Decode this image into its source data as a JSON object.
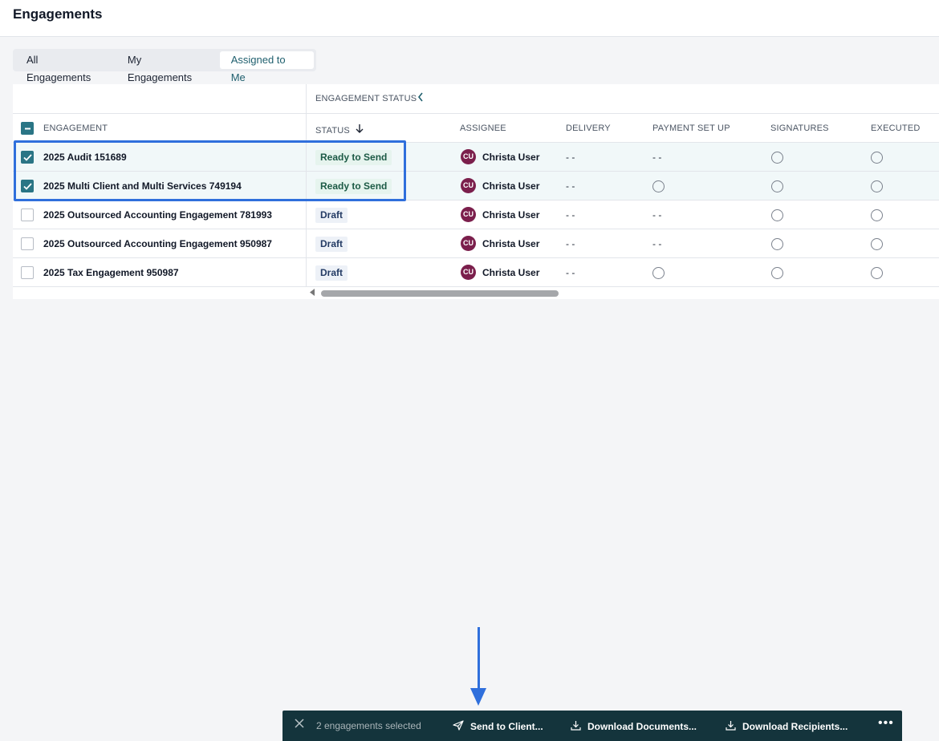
{
  "header": {
    "title": "Engagements"
  },
  "tabs": [
    {
      "label": "All Engagements"
    },
    {
      "label": "My Engagements"
    },
    {
      "label": "Assigned to Me"
    }
  ],
  "table": {
    "group_header": "ENGAGEMENT STATUS",
    "columns": {
      "engagement": "ENGAGEMENT",
      "status": "STATUS",
      "assignee": "ASSIGNEE",
      "delivery": "DELIVERY",
      "payment": "PAYMENT SET UP",
      "signatures": "SIGNATURES",
      "executed": "EXECUTED"
    },
    "rows": [
      {
        "name": "2025 Audit 151689",
        "selected": true,
        "status": "Ready to Send",
        "assignee_initials": "CU",
        "assignee": "Christa User",
        "delivery": "- -",
        "payment": "- -"
      },
      {
        "name": "2025 Multi Client and Multi Services 749194",
        "selected": true,
        "status": "Ready to Send",
        "assignee_initials": "CU",
        "assignee": "Christa User",
        "delivery": "- -",
        "payment": ""
      },
      {
        "name": "2025 Outsourced Accounting Engagement 781993",
        "selected": false,
        "status": "Draft",
        "assignee_initials": "CU",
        "assignee": "Christa User",
        "delivery": "- -",
        "payment": "- -"
      },
      {
        "name": "2025 Outsourced Accounting Engagement 950987",
        "selected": false,
        "status": "Draft",
        "assignee_initials": "CU",
        "assignee": "Christa User",
        "delivery": "- -",
        "payment": "- -"
      },
      {
        "name": "2025 Tax Engagement 950987",
        "selected": false,
        "status": "Draft",
        "assignee_initials": "CU",
        "assignee": "Christa User",
        "delivery": "- -",
        "payment": ""
      }
    ]
  },
  "action_bar": {
    "selected_text": "2 engagements selected",
    "send_label": "Send to Client...",
    "download_docs_label": "Download Documents...",
    "download_recipients_label": "Download Recipients...",
    "more_label": "•••"
  },
  "colors": {
    "accent": "#2a7585",
    "highlight_frame": "#2f6fdc",
    "action_bar_bg": "#14343c",
    "avatar_bg": "#7b1f4c"
  },
  "icons": [
    "close-icon",
    "send-icon",
    "download-icon",
    "more-icon",
    "sort-down-icon",
    "chevron-left-icon",
    "checkbox-icon"
  ]
}
